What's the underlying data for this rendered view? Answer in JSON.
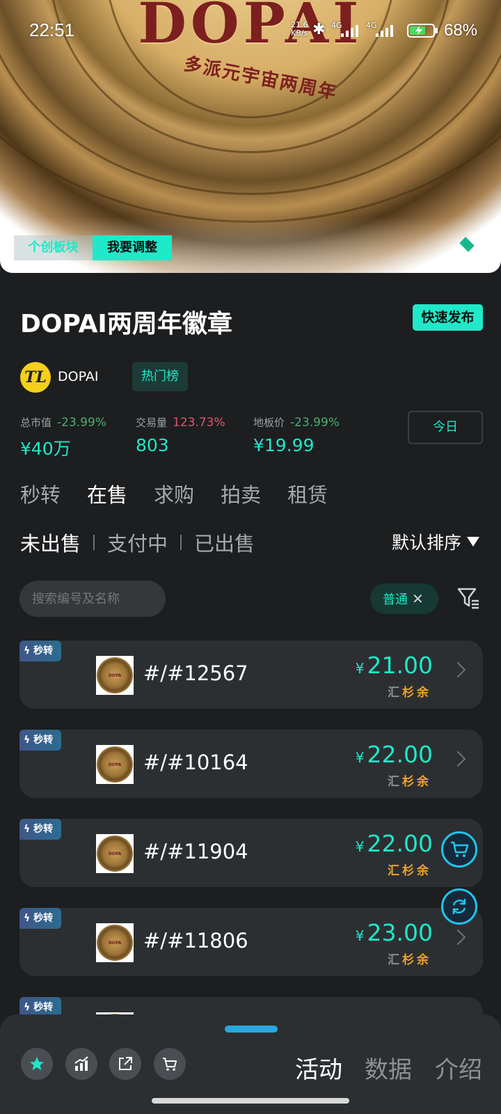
{
  "status": {
    "time": "22:51",
    "netspeed_value": "21.6",
    "netspeed_unit": "KB/s",
    "signal1": "4G",
    "signal2": "4G",
    "battery": "68%"
  },
  "hero": {
    "coin_text": "DOPAI",
    "coin_subtext": "多派元宇宙两周年",
    "tag_section": "个创板块",
    "tag_adjust": "我要调整"
  },
  "item": {
    "title": "DOPAI两周年徽章",
    "quick_publish": "快速发布",
    "creator_logo": "TL",
    "creator_name": "DOPAI",
    "hot_badge": "热门榜"
  },
  "stats": [
    {
      "label": "总市值",
      "change": "-23.99%",
      "value": "¥40万"
    },
    {
      "label": "交易量",
      "change": "123.73%",
      "value": "803"
    },
    {
      "label": "地板价",
      "change": "-23.99%",
      "value": "¥19.99"
    }
  ],
  "today_button": "今日",
  "tabs": [
    "秒转",
    "在售",
    "求购",
    "拍卖",
    "租赁"
  ],
  "subtabs": [
    "未出售",
    "支付中",
    "已出售"
  ],
  "sort_label": "默认排序",
  "search": {
    "placeholder": "搜索编号及名称"
  },
  "filter_chip": "普通",
  "badge_label": "秒转",
  "coin_mini_text": "DOPA",
  "listings": [
    {
      "id": "#/#12567",
      "price": "21.00",
      "sources": [
        "汇",
        "杉",
        "余"
      ],
      "active": [
        false,
        true,
        true
      ]
    },
    {
      "id": "#/#10164",
      "price": "22.00",
      "sources": [
        "汇",
        "杉",
        "余"
      ],
      "active": [
        false,
        true,
        true
      ]
    },
    {
      "id": "#/#11904",
      "price": "22.00",
      "sources": [
        "汇",
        "杉",
        "余"
      ],
      "active": [
        true,
        true,
        true
      ]
    },
    {
      "id": "#/#11806",
      "price": "23.00",
      "sources": [
        "汇",
        "杉",
        "余"
      ],
      "active": [
        false,
        true,
        true
      ]
    }
  ],
  "currency": "¥",
  "bottom_tabs": [
    "活动",
    "数据",
    "介绍"
  ],
  "colors": {
    "accent": "#1de9c8",
    "negative_change": "#4caf6e",
    "positive_change": "#e0556c",
    "source_active": "#f0a42a"
  }
}
